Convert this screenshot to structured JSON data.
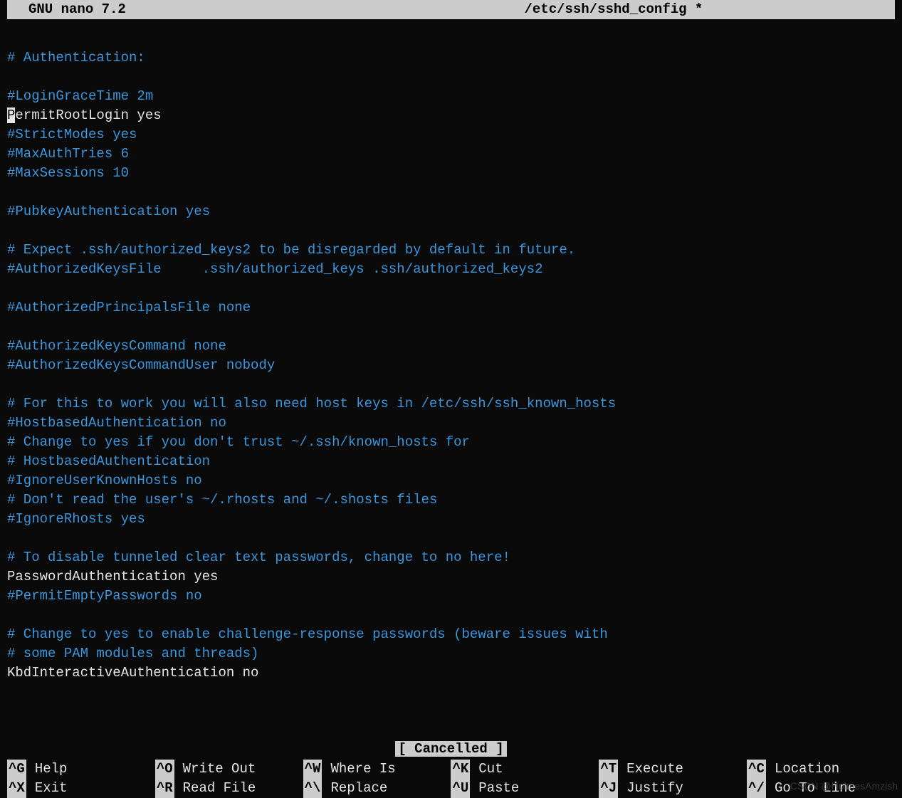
{
  "titlebar": {
    "app": "GNU nano 7.2",
    "file": "/etc/ssh/sshd_config *"
  },
  "lines": [
    {
      "text": "",
      "cls": "normal"
    },
    {
      "text": "# Authentication:",
      "cls": "comment"
    },
    {
      "text": "",
      "cls": "normal"
    },
    {
      "text": "#LoginGraceTime 2m",
      "cls": "comment"
    },
    {
      "text": "PermitRootLogin yes",
      "cls": "normal",
      "cursor": true
    },
    {
      "text": "#StrictModes yes",
      "cls": "comment"
    },
    {
      "text": "#MaxAuthTries 6",
      "cls": "comment"
    },
    {
      "text": "#MaxSessions 10",
      "cls": "comment"
    },
    {
      "text": "",
      "cls": "normal"
    },
    {
      "text": "#PubkeyAuthentication yes",
      "cls": "comment"
    },
    {
      "text": "",
      "cls": "normal"
    },
    {
      "text": "# Expect .ssh/authorized_keys2 to be disregarded by default in future.",
      "cls": "comment"
    },
    {
      "text": "#AuthorizedKeysFile     .ssh/authorized_keys .ssh/authorized_keys2",
      "cls": "comment"
    },
    {
      "text": "",
      "cls": "normal"
    },
    {
      "text": "#AuthorizedPrincipalsFile none",
      "cls": "comment"
    },
    {
      "text": "",
      "cls": "normal"
    },
    {
      "text": "#AuthorizedKeysCommand none",
      "cls": "comment"
    },
    {
      "text": "#AuthorizedKeysCommandUser nobody",
      "cls": "comment"
    },
    {
      "text": "",
      "cls": "normal"
    },
    {
      "text": "# For this to work you will also need host keys in /etc/ssh/ssh_known_hosts",
      "cls": "comment"
    },
    {
      "text": "#HostbasedAuthentication no",
      "cls": "comment"
    },
    {
      "text": "# Change to yes if you don't trust ~/.ssh/known_hosts for",
      "cls": "comment"
    },
    {
      "text": "# HostbasedAuthentication",
      "cls": "comment"
    },
    {
      "text": "#IgnoreUserKnownHosts no",
      "cls": "comment"
    },
    {
      "text": "# Don't read the user's ~/.rhosts and ~/.shosts files",
      "cls": "comment"
    },
    {
      "text": "#IgnoreRhosts yes",
      "cls": "comment"
    },
    {
      "text": "",
      "cls": "normal"
    },
    {
      "text": "# To disable tunneled clear text passwords, change to no here!",
      "cls": "comment"
    },
    {
      "text": "PasswordAuthentication yes",
      "cls": "normal"
    },
    {
      "text": "#PermitEmptyPasswords no",
      "cls": "comment"
    },
    {
      "text": "",
      "cls": "normal"
    },
    {
      "text": "# Change to yes to enable challenge-response passwords (beware issues with",
      "cls": "comment"
    },
    {
      "text": "# some PAM modules and threads)",
      "cls": "comment"
    },
    {
      "text": "KbdInteractiveAuthentication no",
      "cls": "normal"
    }
  ],
  "status": "[ Cancelled ]",
  "shortcuts": {
    "row1": [
      {
        "key": "^G",
        "label": "Help"
      },
      {
        "key": "^O",
        "label": "Write Out"
      },
      {
        "key": "^W",
        "label": "Where Is"
      },
      {
        "key": "^K",
        "label": "Cut"
      },
      {
        "key": "^T",
        "label": "Execute"
      },
      {
        "key": "^C",
        "label": "Location"
      }
    ],
    "row2": [
      {
        "key": "^X",
        "label": "Exit"
      },
      {
        "key": "^R",
        "label": "Read File"
      },
      {
        "key": "^\\",
        "label": "Replace"
      },
      {
        "key": "^U",
        "label": "Paste"
      },
      {
        "key": "^J",
        "label": "Justify"
      },
      {
        "key": "^/",
        "label": "Go To Line"
      }
    ]
  },
  "watermark": "CSDN @HolmesAmzish"
}
